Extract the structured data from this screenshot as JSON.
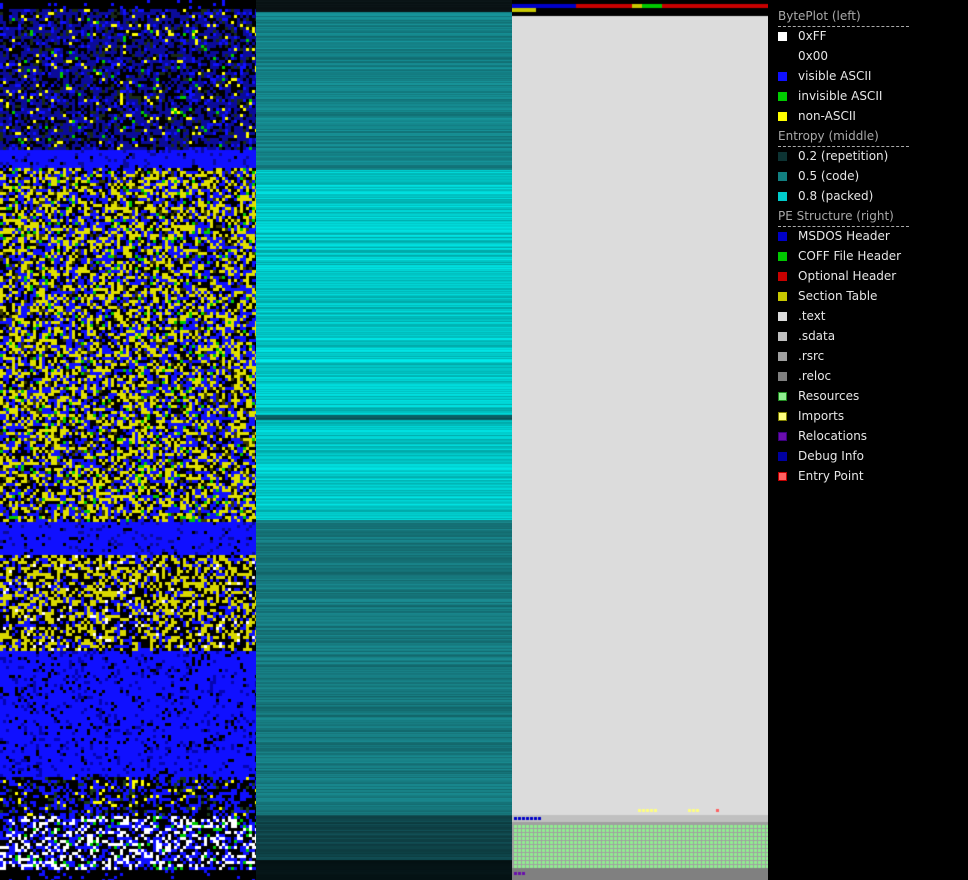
{
  "legend": {
    "sections": [
      {
        "title": "BytePlot (left)",
        "items": [
          {
            "label": "0xFF",
            "color": "#ffffff",
            "name": "swatch-0xff"
          },
          {
            "label": "0x00",
            "color": "#000000",
            "name": "swatch-0x00"
          },
          {
            "label": "visible ASCII",
            "color": "#1010ff",
            "name": "swatch-visible-ascii"
          },
          {
            "label": "invisible ASCII",
            "color": "#00cc00",
            "name": "swatch-invisible-ascii"
          },
          {
            "label": "non-ASCII",
            "color": "#ffff00",
            "name": "swatch-non-ascii"
          }
        ]
      },
      {
        "title": "Entropy (middle)",
        "items": [
          {
            "label": "0.2 (repetition)",
            "color": "#0d3333",
            "name": "swatch-entropy-low"
          },
          {
            "label": "0.5 (code)",
            "color": "#127f80",
            "name": "swatch-entropy-mid"
          },
          {
            "label": "0.8 (packed)",
            "color": "#00cccc",
            "name": "swatch-entropy-high"
          }
        ]
      },
      {
        "title": "PE Structure (right)",
        "items": [
          {
            "label": "MSDOS Header",
            "color": "#0000c8",
            "name": "swatch-msdos-header"
          },
          {
            "label": "COFF File Header",
            "color": "#00c800",
            "name": "swatch-coff-header"
          },
          {
            "label": "Optional Header",
            "color": "#c80000",
            "name": "swatch-optional-header"
          },
          {
            "label": "Section Table",
            "color": "#c8c800",
            "name": "swatch-section-table"
          },
          {
            "label": ".text",
            "color": "#dcdcdc",
            "name": "swatch-text-section"
          },
          {
            "label": ".sdata",
            "color": "#c0c0c0",
            "name": "swatch-sdata-section"
          },
          {
            "label": ".rsrc",
            "color": "#a0a0a0",
            "name": "swatch-rsrc-section"
          },
          {
            "label": ".reloc",
            "color": "#808080",
            "name": "swatch-reloc-section"
          },
          {
            "label": "Resources",
            "color": "#90ee90",
            "border": "#228b22",
            "name": "swatch-resources"
          },
          {
            "label": "Imports",
            "color": "#ffff80",
            "border": "#808000",
            "name": "swatch-imports"
          },
          {
            "label": "Relocations",
            "color": "#6a0dad",
            "border": "#3a007d",
            "name": "swatch-relocations"
          },
          {
            "label": "Debug Info",
            "color": "#0000a0",
            "name": "swatch-debug-info"
          },
          {
            "label": "Entry Point",
            "color": "#ff6060",
            "border": "#c00000",
            "name": "swatch-entry-point"
          }
        ]
      }
    ]
  }
}
